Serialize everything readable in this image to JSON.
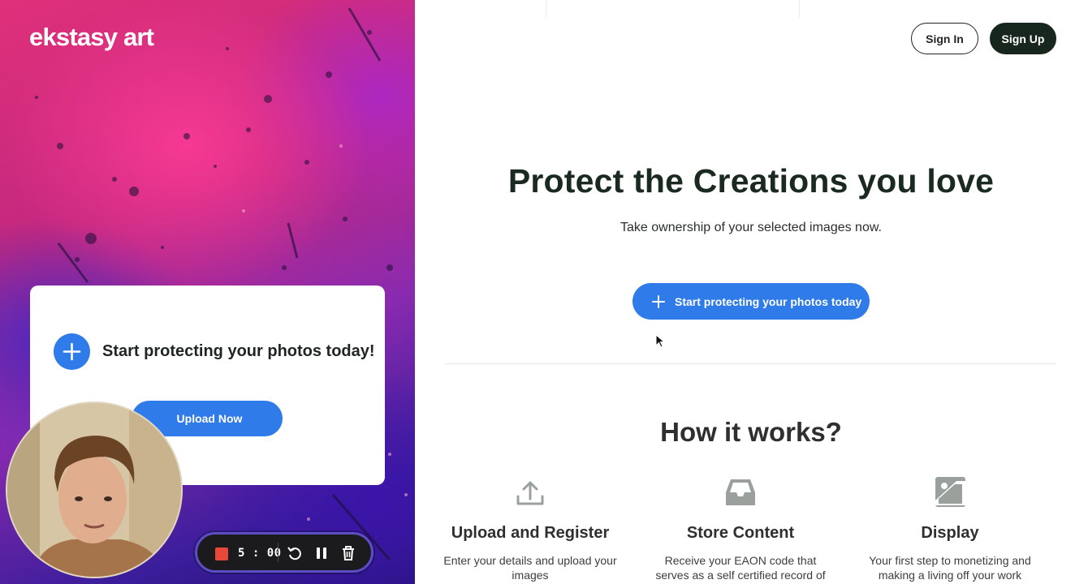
{
  "brand": {
    "logo_text": "ekstasy art"
  },
  "header": {
    "sign_in_label": "Sign In",
    "sign_up_label": "Sign Up"
  },
  "hero": {
    "title": "Protect the Creations you love",
    "subtitle": "Take ownership of your selected images now.",
    "cta_label": "Start protecting your photos today"
  },
  "promo_card": {
    "text": "Start protecting your photos today!",
    "upload_label": "Upload Now"
  },
  "how_it_works": {
    "title": "How it works?",
    "steps": [
      {
        "icon": "upload-icon",
        "title": "Upload and Register",
        "description": "Enter your details and upload your images"
      },
      {
        "icon": "inbox-icon",
        "title": "Store Content",
        "description": "Receive your EAON code that serves as a self certified record of"
      },
      {
        "icon": "image-icon",
        "title": "Display",
        "description": "Your first step to monetizing and making a living off your work"
      }
    ]
  },
  "recorder": {
    "time": "5 : 00"
  },
  "colors": {
    "accent": "#2f7be9",
    "dark": "#17271d",
    "record": "#e8483a"
  }
}
